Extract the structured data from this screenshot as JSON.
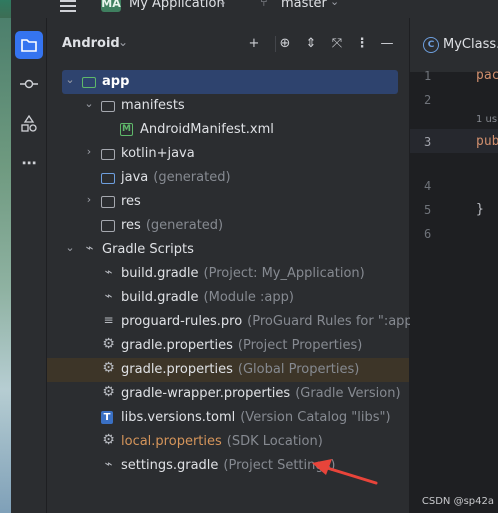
{
  "topbar": {
    "project_badge": "MA",
    "project_name": "My Application",
    "branch_name": "master"
  },
  "toolstrip": {
    "items": [
      {
        "icon": "folder-icon",
        "active": true
      },
      {
        "icon": "commit-icon",
        "active": false
      },
      {
        "icon": "shapes-icon",
        "active": false
      },
      {
        "icon": "more-icon",
        "active": false
      }
    ]
  },
  "panel": {
    "title": "Android",
    "tree": [
      {
        "label": "app",
        "hint": "",
        "icon": "module-folder-icon",
        "level": 0,
        "expanded": true,
        "selected": true
      },
      {
        "label": "manifests",
        "hint": "",
        "icon": "folder-icon",
        "level": 1,
        "expanded": true
      },
      {
        "label": "AndroidManifest.xml",
        "hint": "",
        "icon": "manifest-file-icon",
        "level": 2
      },
      {
        "label": "kotlin+java",
        "hint": "",
        "icon": "folder-icon",
        "level": 1,
        "expanded": false
      },
      {
        "label": "java",
        "hint": "(generated)",
        "icon": "generated-folder-icon",
        "level": 1
      },
      {
        "label": "res",
        "hint": "",
        "icon": "res-folder-icon",
        "level": 1,
        "expanded": false
      },
      {
        "label": "res",
        "hint": "(generated)",
        "icon": "res-folder-icon",
        "level": 1
      },
      {
        "label": "Gradle Scripts",
        "hint": "",
        "icon": "gradle-icon",
        "level": 0,
        "expanded": true
      },
      {
        "label": "build.gradle",
        "hint": "(Project: My_Application)",
        "icon": "gradle-icon",
        "level": 1
      },
      {
        "label": "build.gradle",
        "hint": "(Module :app)",
        "icon": "gradle-icon",
        "level": 1
      },
      {
        "label": "proguard-rules.pro",
        "hint": "(ProGuard Rules for \":app\")",
        "icon": "text-file-icon",
        "level": 1
      },
      {
        "label": "gradle.properties",
        "hint": "(Project Properties)",
        "icon": "gear-icon",
        "level": 1
      },
      {
        "label": "gradle.properties",
        "hint": "(Global Properties)",
        "icon": "gear-icon",
        "level": 1,
        "highlight": true
      },
      {
        "label": "gradle-wrapper.properties",
        "hint": "(Gradle Version)",
        "icon": "gear-icon",
        "level": 1
      },
      {
        "label": "libs.versions.toml",
        "hint": "(Version Catalog \"libs\")",
        "icon": "toml-icon",
        "level": 1
      },
      {
        "label": "local.properties",
        "hint": "(SDK Location)",
        "icon": "gear-icon",
        "level": 1,
        "orange": true
      },
      {
        "label": "settings.gradle",
        "hint": "(Project Settings)",
        "icon": "gradle-icon",
        "level": 1
      }
    ]
  },
  "editor": {
    "tab_label": "MyClass.j",
    "lines": [
      {
        "num": "1",
        "code": "pac",
        "kind": "kw"
      },
      {
        "num": "2",
        "code": "",
        "kind": "plain"
      },
      {
        "num": "3",
        "code": "pub",
        "kind": "kw",
        "current": true
      },
      {
        "num": "4",
        "code": "",
        "kind": "plain"
      },
      {
        "num": "5",
        "code": "}",
        "kind": "plain"
      },
      {
        "num": "6",
        "code": "",
        "kind": "plain"
      }
    ],
    "inlay_hint": "1 us"
  },
  "watermark": "CSDN @sp42a",
  "colors": {
    "accent": "#3574f0",
    "selection": "#2e436e",
    "highlight_row": "#3d3528",
    "arrow": "#e8443a",
    "orange_text": "#d5955b"
  }
}
